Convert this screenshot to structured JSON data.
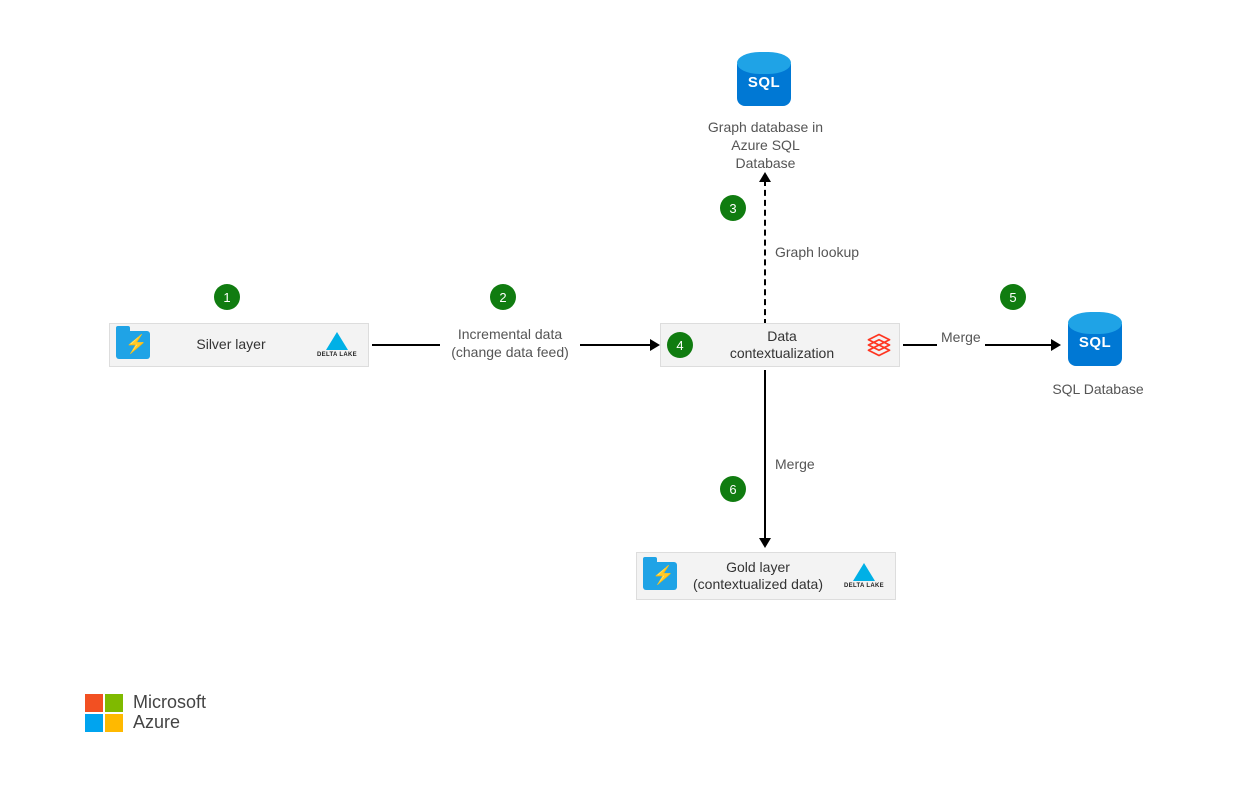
{
  "nodes": {
    "silver": {
      "label": "Silver layer"
    },
    "context": {
      "label_line1": "Data",
      "label_line2": "contextualization"
    },
    "gold": {
      "label_line1": "Gold layer",
      "label_line2": "(contextualized data)"
    },
    "graphdb": {
      "label_line1": "Graph database in",
      "label_line2": "Azure SQL",
      "label_line3": "Database"
    },
    "sqldb": {
      "label": "SQL Database"
    }
  },
  "edges": {
    "incremental": {
      "line1": "Incremental data",
      "line2": "(change data feed)"
    },
    "graph_lookup": "Graph lookup",
    "merge_right": "Merge",
    "merge_down": "Merge"
  },
  "steps": {
    "s1": "1",
    "s2": "2",
    "s3": "3",
    "s4": "4",
    "s5": "5",
    "s6": "6"
  },
  "icons": {
    "sql_text": "SQL",
    "delta_label": "DELTA LAKE"
  },
  "footer": {
    "brand_line1": "Microsoft",
    "brand_line2": "Azure"
  }
}
